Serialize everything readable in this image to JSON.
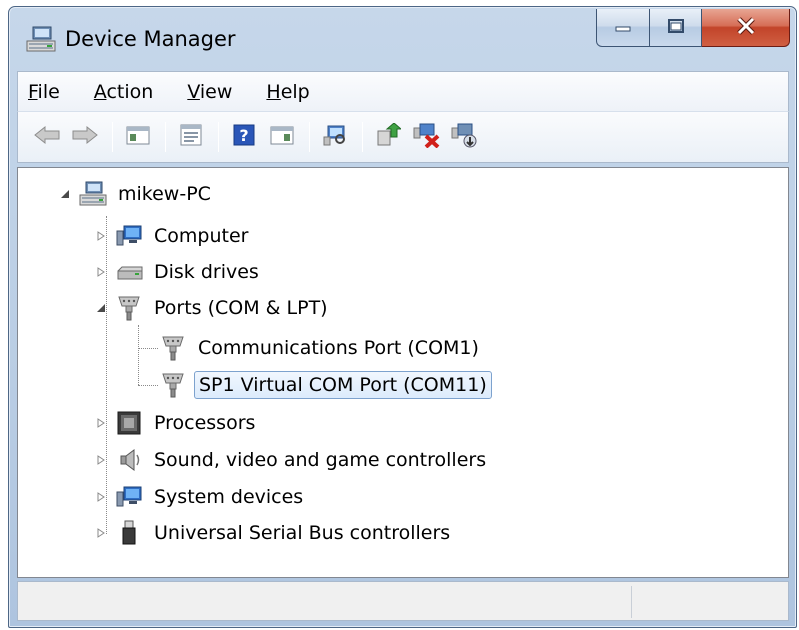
{
  "window": {
    "title": "Device Manager",
    "title_icon": "device-manager-icon",
    "buttons": [
      "minimize-icon",
      "maximize-icon",
      "close-icon"
    ]
  },
  "menu": {
    "items": [
      {
        "label_u": "F",
        "label_rest": "ile"
      },
      {
        "label_u": "A",
        "label_rest": "ction"
      },
      {
        "label_u": "V",
        "label_rest": "iew"
      },
      {
        "label_u": "H",
        "label_rest": "elp"
      }
    ]
  },
  "toolbar": {
    "icons": [
      "back-icon",
      "forward-icon",
      "show-hide-console-tree-icon",
      "properties-icon",
      "help-icon",
      "show-hide-action-pane-icon",
      "scan-hardware-icon",
      "update-driver-icon",
      "uninstall-icon",
      "disable-device-icon"
    ]
  },
  "tree": {
    "root": {
      "label": "mikew-PC",
      "icon": "computer-icon",
      "expanded": true
    },
    "items": [
      {
        "label": "Computer",
        "icon": "computer-icon",
        "expanded": false
      },
      {
        "label": "Disk drives",
        "icon": "disk-drive-icon",
        "expanded": false
      },
      {
        "label": "Ports (COM & LPT)",
        "icon": "port-icon",
        "expanded": true
      },
      {
        "label": "Communications Port (COM1)",
        "icon": "port-icon"
      },
      {
        "label": "SP1 Virtual COM Port (COM11)",
        "icon": "port-icon",
        "selected": true
      },
      {
        "label": "Processors",
        "icon": "processor-icon",
        "expanded": false
      },
      {
        "label": "Sound, video and game controllers",
        "icon": "speaker-icon",
        "expanded": false
      },
      {
        "label": "System devices",
        "icon": "system-devices-icon",
        "expanded": false
      },
      {
        "label": "Universal Serial Bus controllers",
        "icon": "usb-icon",
        "expanded": false
      }
    ]
  },
  "colors": {
    "selection_border": "#7da2ce",
    "selection_fill": "#dcebfc",
    "close_button": "#c2442a"
  }
}
